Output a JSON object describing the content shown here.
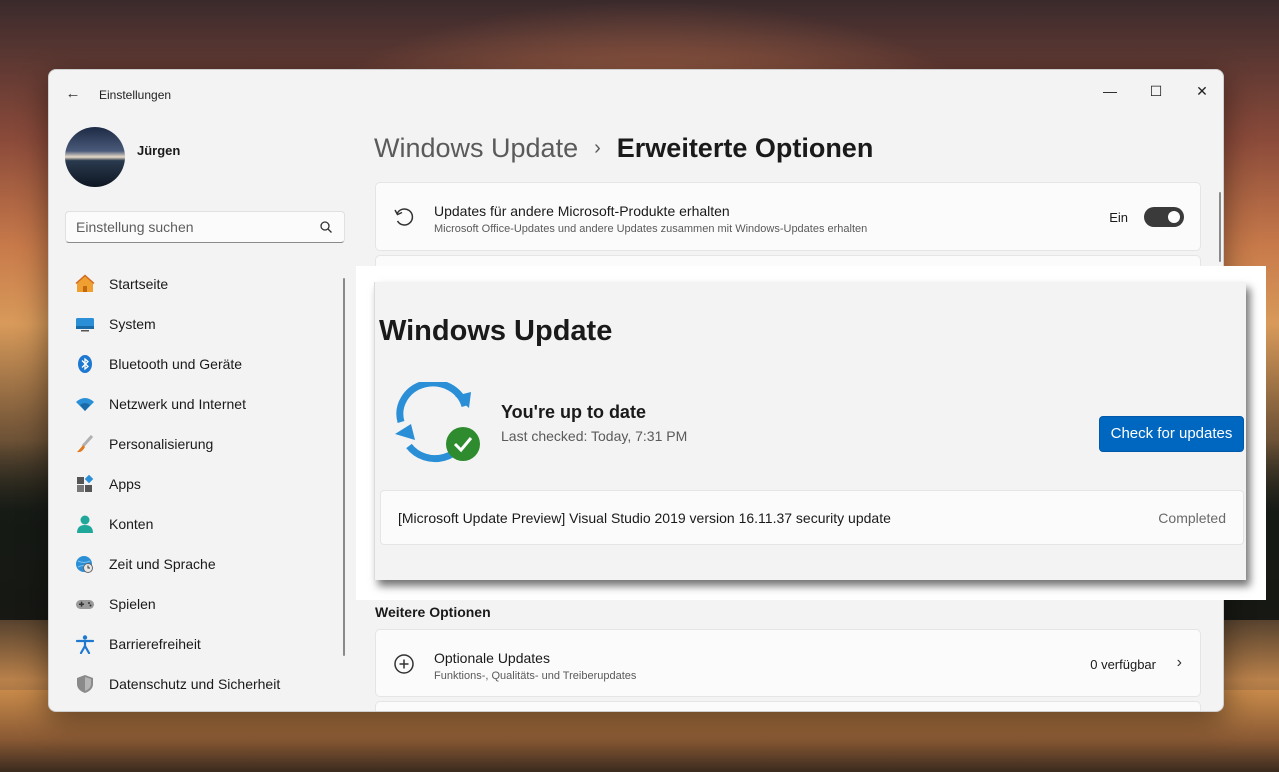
{
  "window": {
    "title": "Einstellungen",
    "controls": {
      "minimize": "—",
      "maximize": "☐",
      "close": "✕"
    }
  },
  "profile": {
    "name": "Jürgen"
  },
  "search": {
    "placeholder": "Einstellung suchen",
    "value": ""
  },
  "sidebar": {
    "items": [
      {
        "label": "Startseite",
        "icon": "home-icon"
      },
      {
        "label": "System",
        "icon": "monitor-icon"
      },
      {
        "label": "Bluetooth und Geräte",
        "icon": "bluetooth-icon"
      },
      {
        "label": "Netzwerk und Internet",
        "icon": "wifi-icon"
      },
      {
        "label": "Personalisierung",
        "icon": "brush-icon"
      },
      {
        "label": "Apps",
        "icon": "apps-icon"
      },
      {
        "label": "Konten",
        "icon": "person-icon"
      },
      {
        "label": "Zeit und Sprache",
        "icon": "globe-clock-icon"
      },
      {
        "label": "Spielen",
        "icon": "gamepad-icon"
      },
      {
        "label": "Barrierefreiheit",
        "icon": "accessibility-icon"
      },
      {
        "label": "Datenschutz und Sicherheit",
        "icon": "shield-icon"
      }
    ]
  },
  "breadcrumb": {
    "parent": "Windows Update",
    "separator": "›",
    "current": "Erweiterte Optionen"
  },
  "settings": {
    "other_products": {
      "title": "Updates für andere Microsoft-Produkte erhalten",
      "subtitle": "Microsoft Office-Updates und andere Updates zusammen mit Windows-Updates erhalten",
      "status": "Ein",
      "enabled": true
    },
    "more_options_heading": "Weitere Optionen",
    "optional_updates": {
      "title": "Optionale Updates",
      "subtitle": "Funktions-, Qualitäts- und Treiberupdates",
      "count": "0 verfügbar"
    }
  },
  "overlay": {
    "title": "Windows Update",
    "status_title": "You're up to date",
    "status_sub": "Last checked: Today, 7:31 PM",
    "check_button": "Check for updates",
    "update": {
      "name": "[Microsoft Update Preview] Visual Studio 2019 version 16.11.37 security update",
      "status": "Completed"
    }
  },
  "colors": {
    "accent": "#0067c0",
    "success": "#2e8b2e",
    "sync_blue": "#2a8fd6"
  }
}
